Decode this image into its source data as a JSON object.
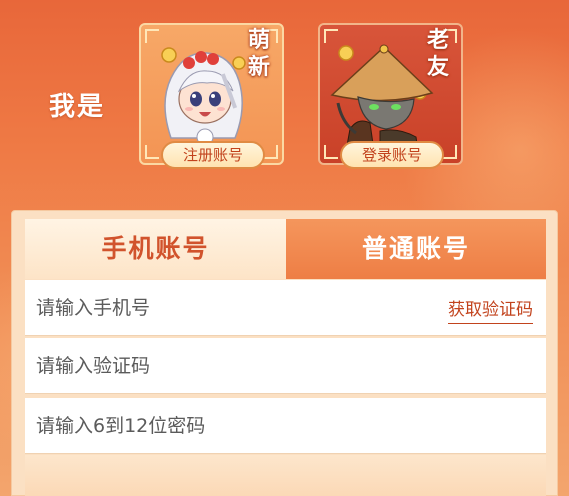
{
  "header": {
    "iam_label": "我是"
  },
  "roles": [
    {
      "title": "萌新",
      "button_label": "注册账号"
    },
    {
      "title": "老友",
      "button_label": "登录账号"
    }
  ],
  "tabs": [
    {
      "label": "手机账号",
      "active": true
    },
    {
      "label": "普通账号",
      "active": false
    }
  ],
  "form": {
    "phone_placeholder": "请输入手机号",
    "get_code_label": "获取验证码",
    "code_placeholder": "请输入验证码",
    "password_placeholder": "请输入6到12位密码"
  },
  "colors": {
    "accent": "#c2431d",
    "background": "#ef7a45",
    "tab_active_bg": "#fde4c7",
    "tab_inactive_bg": "#f08a52"
  }
}
